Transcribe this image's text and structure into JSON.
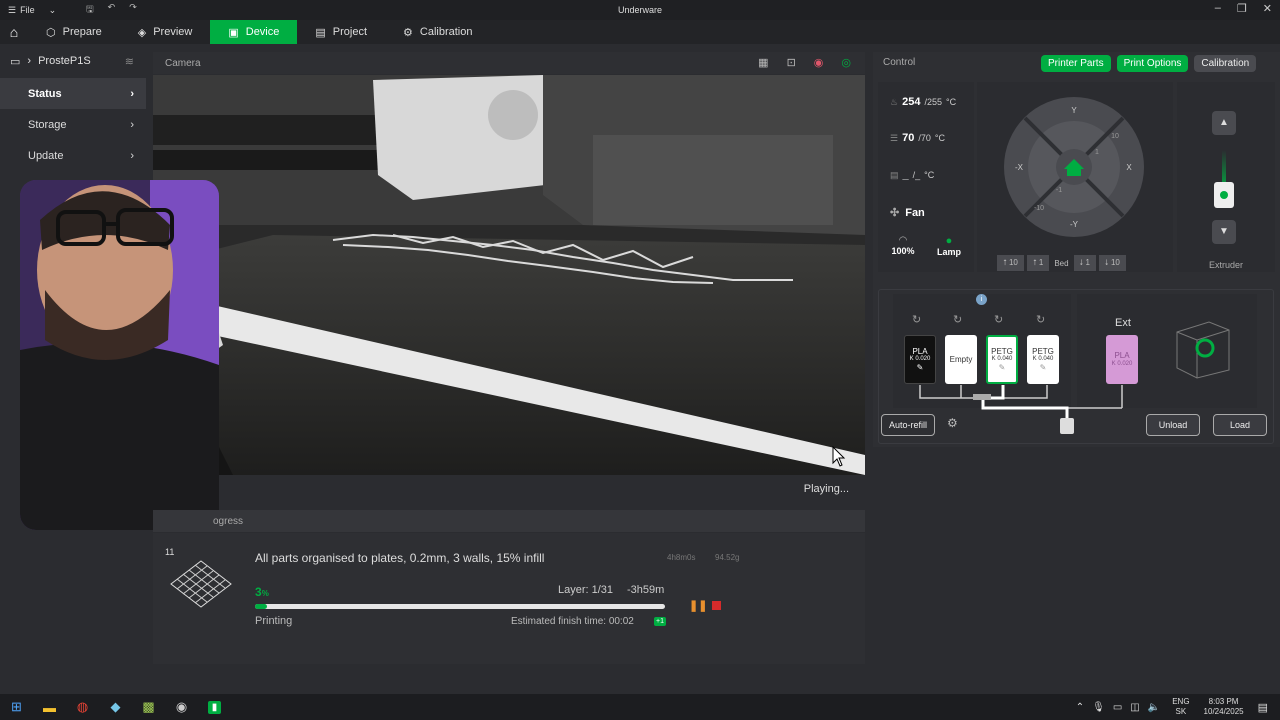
{
  "window": {
    "title": "Underware",
    "file_menu": "File"
  },
  "tabs": [
    {
      "label": "Prepare"
    },
    {
      "label": "Preview"
    },
    {
      "label": "Device"
    },
    {
      "label": "Project"
    },
    {
      "label": "Calibration"
    }
  ],
  "sidebar": {
    "printer_name": "ProsteP1S",
    "items": [
      {
        "label": "Status"
      },
      {
        "label": "Storage"
      },
      {
        "label": "Update"
      }
    ]
  },
  "camera": {
    "title": "Camera",
    "status": "Playing..."
  },
  "progress": {
    "title": "ogress",
    "plate_number": "11",
    "description": "All parts organised to plates, 0.2mm, 3 walls, 15% infill",
    "time_total": "4h8m0s",
    "weight": "94.52g",
    "percent": "3",
    "percent_unit": "%",
    "percent_value": 3,
    "layer": "Layer: 1/31",
    "remaining": "-3h59m",
    "state": "Printing",
    "finish_time": "Estimated finish time: 00:02",
    "day_badge": "+1"
  },
  "control": {
    "title": "Control",
    "buttons": {
      "printer_parts": "Printer Parts",
      "print_options": "Print Options",
      "calibration": "Calibration"
    },
    "nozzle": {
      "current": "254",
      "target": "/255",
      "unit": "°C"
    },
    "bed": {
      "current": "70",
      "target": "/70",
      "unit": "°C"
    },
    "chamber": {
      "current": "_",
      "target": "/_",
      "unit": "°C"
    },
    "fan_label": "Fan",
    "speed_label": "100%",
    "lamp_label": "Lamp",
    "jog": {
      "y_plus": "Y",
      "y_minus": "-Y",
      "x_plus": "X",
      "x_minus": "-X",
      "d10": "10",
      "d1": "1",
      "dm1": "-1",
      "dm10": "-10"
    },
    "bed_controls": {
      "up10": "10",
      "up1": "1",
      "label": "Bed",
      "down1": "1",
      "down10": "10"
    },
    "extruder_label": "Extruder"
  },
  "ams": {
    "slots": [
      {
        "material": "PLA",
        "k": "K 0.020",
        "color": "#111111"
      },
      {
        "material": "Empty",
        "k": "",
        "color": "#ffffff"
      },
      {
        "material": "PETG",
        "k": "K 0.040",
        "color": "#ffffff"
      },
      {
        "material": "PETG",
        "k": "K 0.040",
        "color": "#ffffff"
      }
    ],
    "ext_label": "Ext",
    "ext_slot": {
      "material": "PLA",
      "k": "K 0.020",
      "color": "#d59ad6"
    },
    "auto_refill": "Auto-refill",
    "unload": "Unload",
    "load": "Load"
  },
  "taskbar": {
    "lang_top": "ENG",
    "lang_bottom": "SK",
    "time": "8:03 PM",
    "date": "10/24/2025"
  },
  "colors": {
    "accent": "#00ae42",
    "background": "#2b2c30"
  }
}
